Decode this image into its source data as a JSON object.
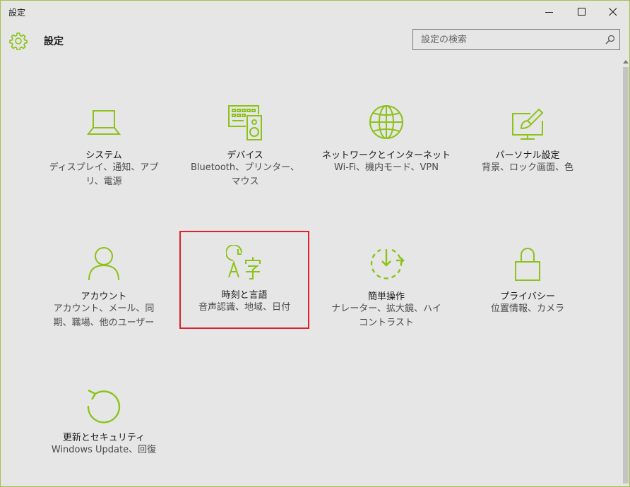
{
  "window": {
    "title": "設定",
    "min_icon": "minimize-icon",
    "max_icon": "maximize-icon",
    "close_icon": "close-icon"
  },
  "header": {
    "title": "設定",
    "icon": "gear-icon",
    "search_placeholder": "設定の検索",
    "search_value": ""
  },
  "accent_color": "#8cc21a",
  "selection_color": "#e0202a",
  "tiles": [
    {
      "name": "システム",
      "desc": "ディスプレイ、通知、アプリ、電源",
      "icon": "laptop-icon"
    },
    {
      "name": "デバイス",
      "desc": "Bluetooth、プリンター、マウス",
      "icon": "devices-icon"
    },
    {
      "name": "ネットワークとインターネット",
      "desc": "Wi-Fi、機内モード、VPN",
      "icon": "globe-icon"
    },
    {
      "name": "パーソナル設定",
      "desc": "背景、ロック画面、色",
      "icon": "paint-icon"
    },
    {
      "name": "アカウント",
      "desc": "アカウント、メール、同期、職場、他のユーザー",
      "icon": "person-icon"
    },
    {
      "name": "時刻と言語",
      "desc": "音声認識、地域、日付",
      "icon": "time-language-icon",
      "selected": true
    },
    {
      "name": "簡単操作",
      "desc": "ナレーター、拡大鏡、ハイコントラスト",
      "icon": "ease-of-access-icon"
    },
    {
      "name": "プライバシー",
      "desc": "位置情報、カメラ",
      "icon": "lock-icon"
    },
    {
      "name": "更新とセキュリティ",
      "desc": "Windows Update、回復",
      "icon": "refresh-icon"
    }
  ]
}
